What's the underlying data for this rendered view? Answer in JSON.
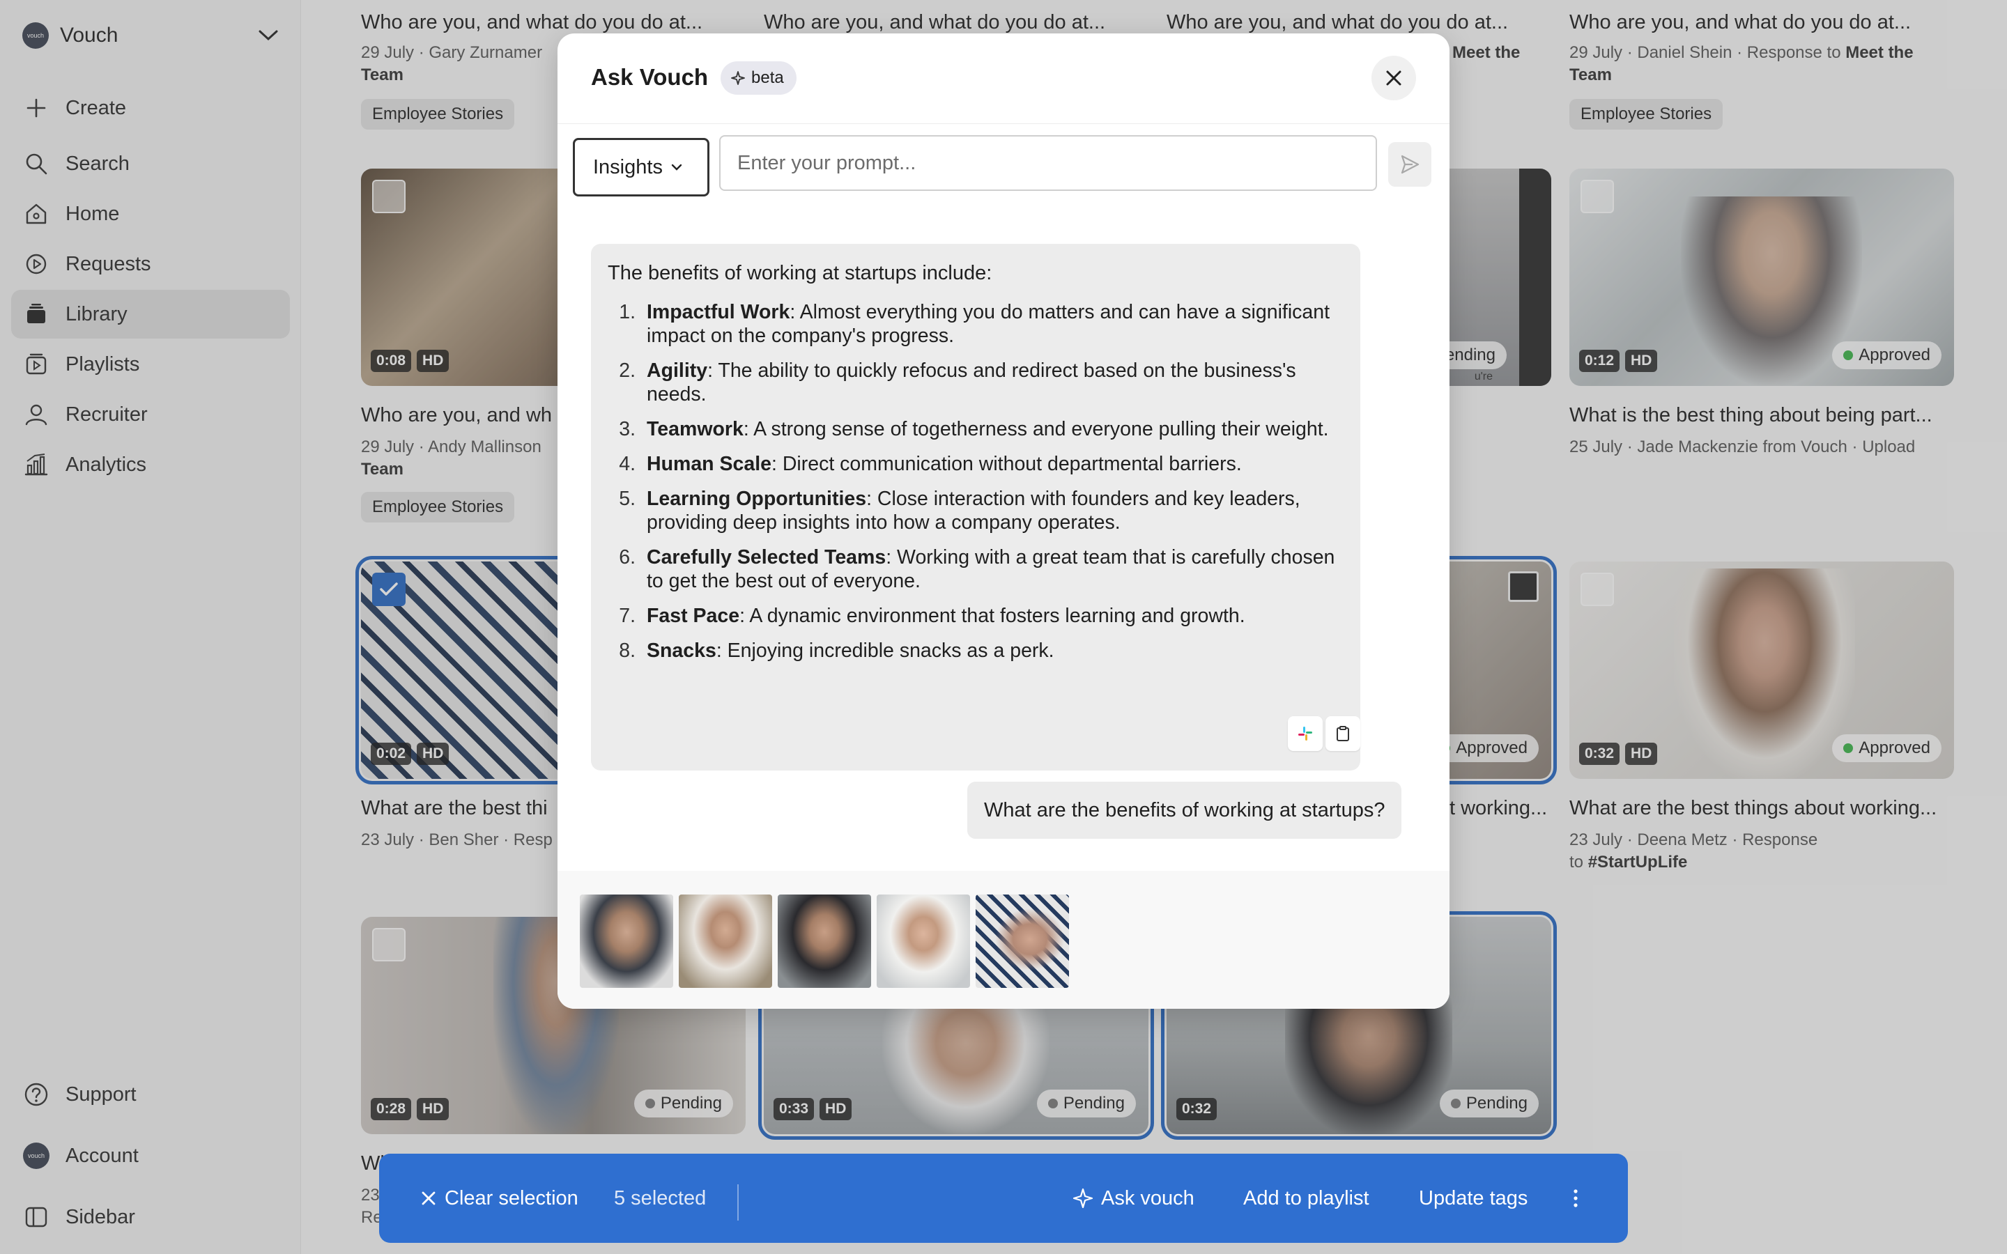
{
  "workspace": {
    "name": "Vouch",
    "logo_text": "vouch"
  },
  "nav": {
    "create": "Create",
    "search": "Search",
    "home": "Home",
    "requests": "Requests",
    "library": "Library",
    "playlists": "Playlists",
    "recruiter": "Recruiter",
    "analytics": "Analytics",
    "support": "Support",
    "account": "Account",
    "sidebar": "Sidebar"
  },
  "cards": {
    "r0c0": {
      "title": "Who are you, and what do you do at...",
      "meta_pre": "29 July · Gary Zurnamer",
      "meta_line2": "Team",
      "tag": "Employee Stories"
    },
    "r0c1": {
      "title": "Who are you, and what do you do at..."
    },
    "r0c2": {
      "title": "Who are you, and what do you do at...",
      "meta_bold": "Meet the"
    },
    "r0c3": {
      "title": "Who are you, and what do you do at...",
      "meta_pre": "29 July · Daniel Shein · Response to ",
      "meta_bold": "Meet the",
      "meta_line2": "Team",
      "tag": "Employee Stories"
    },
    "r1c0": {
      "duration": "0:08",
      "hd": "HD",
      "title": "Who are you, and wh",
      "meta_pre": "29 July · Andy Mallinson",
      "meta_line2": "Team",
      "tag": "Employee Stories"
    },
    "r1c2": {
      "status": "Pending",
      "subtext": "u're"
    },
    "r1c3": {
      "duration": "0:12",
      "hd": "HD",
      "status": "Approved",
      "title": "What is the best thing about being part...",
      "meta_pre": "25 July · Jade Mackenzie from Vouch · Upload"
    },
    "r2c0": {
      "duration": "0:02",
      "hd": "HD",
      "title": "What are the best thi",
      "meta_pre": "23 July · Ben Sher · Resp"
    },
    "r2c2": {
      "status": "Approved",
      "title": "t working..."
    },
    "r2c3": {
      "duration": "0:32",
      "hd": "HD",
      "status": "Approved",
      "title": "What are the best things about working...",
      "meta_pre": "23 July · Deena Metz · Response",
      "meta_line2_pre": "to ",
      "meta_line2_bold": "#StartUpLife"
    },
    "r3c0": {
      "duration": "0:28",
      "hd": "HD",
      "status": "Pending",
      "title": "Wh",
      "meta_pre": "23",
      "meta_line2": "Re"
    },
    "r3c1": {
      "duration": "0:33",
      "hd": "HD",
      "status": "Pending"
    },
    "r3c2": {
      "duration": "0:32",
      "status": "Pending"
    }
  },
  "modal": {
    "title": "Ask Vouch",
    "beta": "beta",
    "mode": "Insights",
    "prompt_placeholder": "Enter your prompt...",
    "answer_intro": "The benefits of working at startups include:",
    "answer_items": [
      {
        "num": "1.",
        "bold": "Impactful Work",
        "text": ": Almost everything you do matters and can have a significant impact on the company's progress."
      },
      {
        "num": "2.",
        "bold": "Agility",
        "text": ": The ability to quickly refocus and redirect based on the business's needs."
      },
      {
        "num": "3.",
        "bold": "Teamwork",
        "text": ": A strong sense of togetherness and everyone pulling their weight."
      },
      {
        "num": "4.",
        "bold": "Human Scale",
        "text": ": Direct communication without departmental barriers."
      },
      {
        "num": "5.",
        "bold": "Learning Opportunities",
        "text": ": Close interaction with founders and key leaders, providing deep insights into how a company operates."
      },
      {
        "num": "6.",
        "bold": "Carefully Selected Teams",
        "text": ": Working with a great team that is carefully chosen to get the best out of everyone."
      },
      {
        "num": "7.",
        "bold": "Fast Pace",
        "text": ": A dynamic environment that fosters learning and growth."
      },
      {
        "num": "8.",
        "bold": "Snacks",
        "text": ": Enjoying incredible snacks as a perk."
      }
    ],
    "question": "What are the benefits of working at startups?"
  },
  "actionbar": {
    "clear": "Clear selection",
    "selected": "5 selected",
    "ask": "Ask vouch",
    "playlist": "Add to playlist",
    "tags": "Update tags"
  },
  "colors": {
    "accent": "#2f6fd0",
    "approved": "#3cb34a",
    "pending": "#7a7a7a"
  }
}
